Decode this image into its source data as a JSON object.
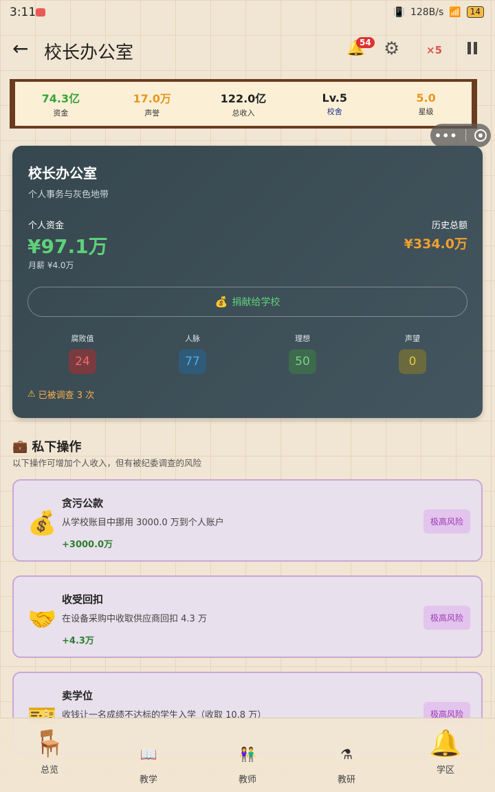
{
  "status_bar": {
    "time": "3:11",
    "net_speed": "128B/s",
    "battery": "14"
  },
  "header": {
    "title": "校长办公室",
    "notification_count": "54",
    "speed": "×5"
  },
  "stats": [
    {
      "value": "74.3亿",
      "label": "资金",
      "color": "#3aa33a"
    },
    {
      "value": "17.0万",
      "label": "声誉",
      "color": "#e8961e"
    },
    {
      "value": "122.0亿",
      "label": "总收入",
      "color": "#222222"
    },
    {
      "value": "Lv.5",
      "label": "校舍",
      "color": "#222222"
    },
    {
      "value": "5.0",
      "label": "星级",
      "color": "#e8961e"
    }
  ],
  "office": {
    "title": "校长办公室",
    "subtitle": "个人事务与灰色地带",
    "funds_label": "个人资金",
    "funds_value": "¥97.1万",
    "salary": "月薪 ¥4.0万",
    "history_label": "历史总额",
    "history_value": "¥334.0万",
    "donate_label": "捐献给学校",
    "metrics": [
      {
        "label": "腐败值",
        "value": "24",
        "bg": "#7a3b40",
        "fg": "#f06a6a"
      },
      {
        "label": "人脉",
        "value": "77",
        "bg": "#2f5b7a",
        "fg": "#5aaae0"
      },
      {
        "label": "理想",
        "value": "50",
        "bg": "#3e6a4e",
        "fg": "#7bd08a"
      },
      {
        "label": "声望",
        "value": "0",
        "bg": "#6a6a3e",
        "fg": "#e0c84a"
      }
    ],
    "warning": "已被调查 3 次"
  },
  "section": {
    "title": "私下操作",
    "subtitle": "以下操作可增加个人收入，但有被纪委调查的风险"
  },
  "actions": [
    {
      "title": "贪污公款",
      "desc": "从学校账目中挪用 3000.0 万到个人账户",
      "gain": "+3000.0万",
      "risk": "极高风险",
      "icon": "money-bag-icon"
    },
    {
      "title": "收受回扣",
      "desc": "在设备采购中收取供应商回扣 4.3 万",
      "gain": "+4.3万",
      "risk": "极高风险",
      "icon": "handshake-icon"
    },
    {
      "title": "卖学位",
      "desc": "收钱让一名成绩不达标的学生入学（收取 10.8 万）",
      "gain": "",
      "risk": "极高风险",
      "icon": "ticket-icon"
    }
  ],
  "nav": [
    {
      "label": "总览",
      "icon": "desk-icon"
    },
    {
      "label": "教学",
      "icon": "book-icon"
    },
    {
      "label": "教师",
      "icon": "people-icon"
    },
    {
      "label": "教研",
      "icon": "flask-icon"
    },
    {
      "label": "学区",
      "icon": "bell-tower-icon"
    }
  ]
}
